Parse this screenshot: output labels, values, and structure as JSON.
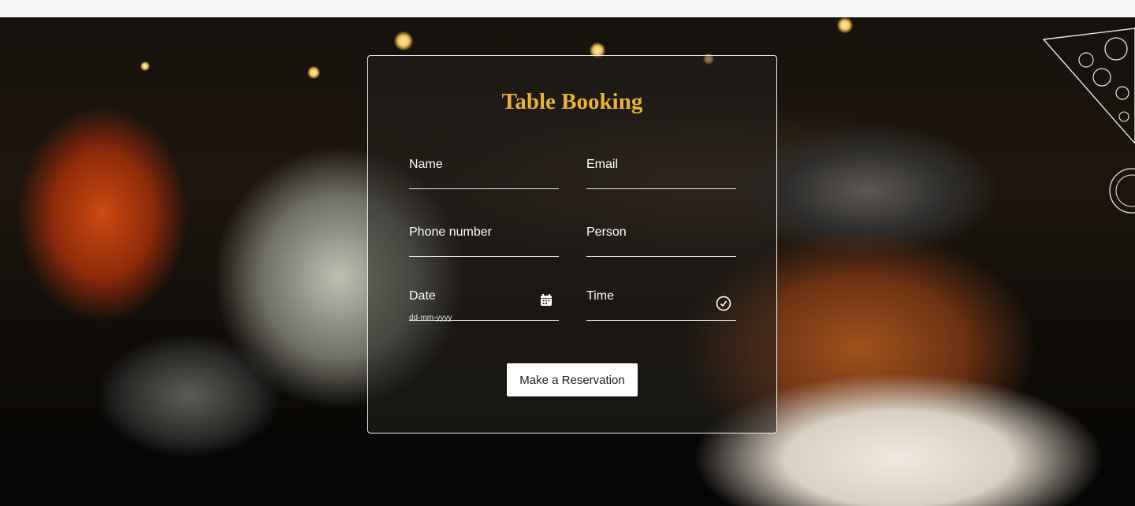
{
  "booking": {
    "title": "Table Booking",
    "fields": {
      "name": {
        "label": "Name",
        "value": ""
      },
      "email": {
        "label": "Email",
        "value": ""
      },
      "phone": {
        "label": "Phone number",
        "value": ""
      },
      "person": {
        "label": "Person",
        "value": ""
      },
      "date": {
        "label": "Date",
        "placeholder": "dd-mm-yyyy",
        "icon": "calendar-icon"
      },
      "time": {
        "label": "Time",
        "icon": "clock-icon"
      }
    },
    "submit_label": "Make a Reservation"
  },
  "colors": {
    "title_accent": "#eab335",
    "panel_border": "#f2f2f2",
    "button_bg": "#ffffff"
  }
}
